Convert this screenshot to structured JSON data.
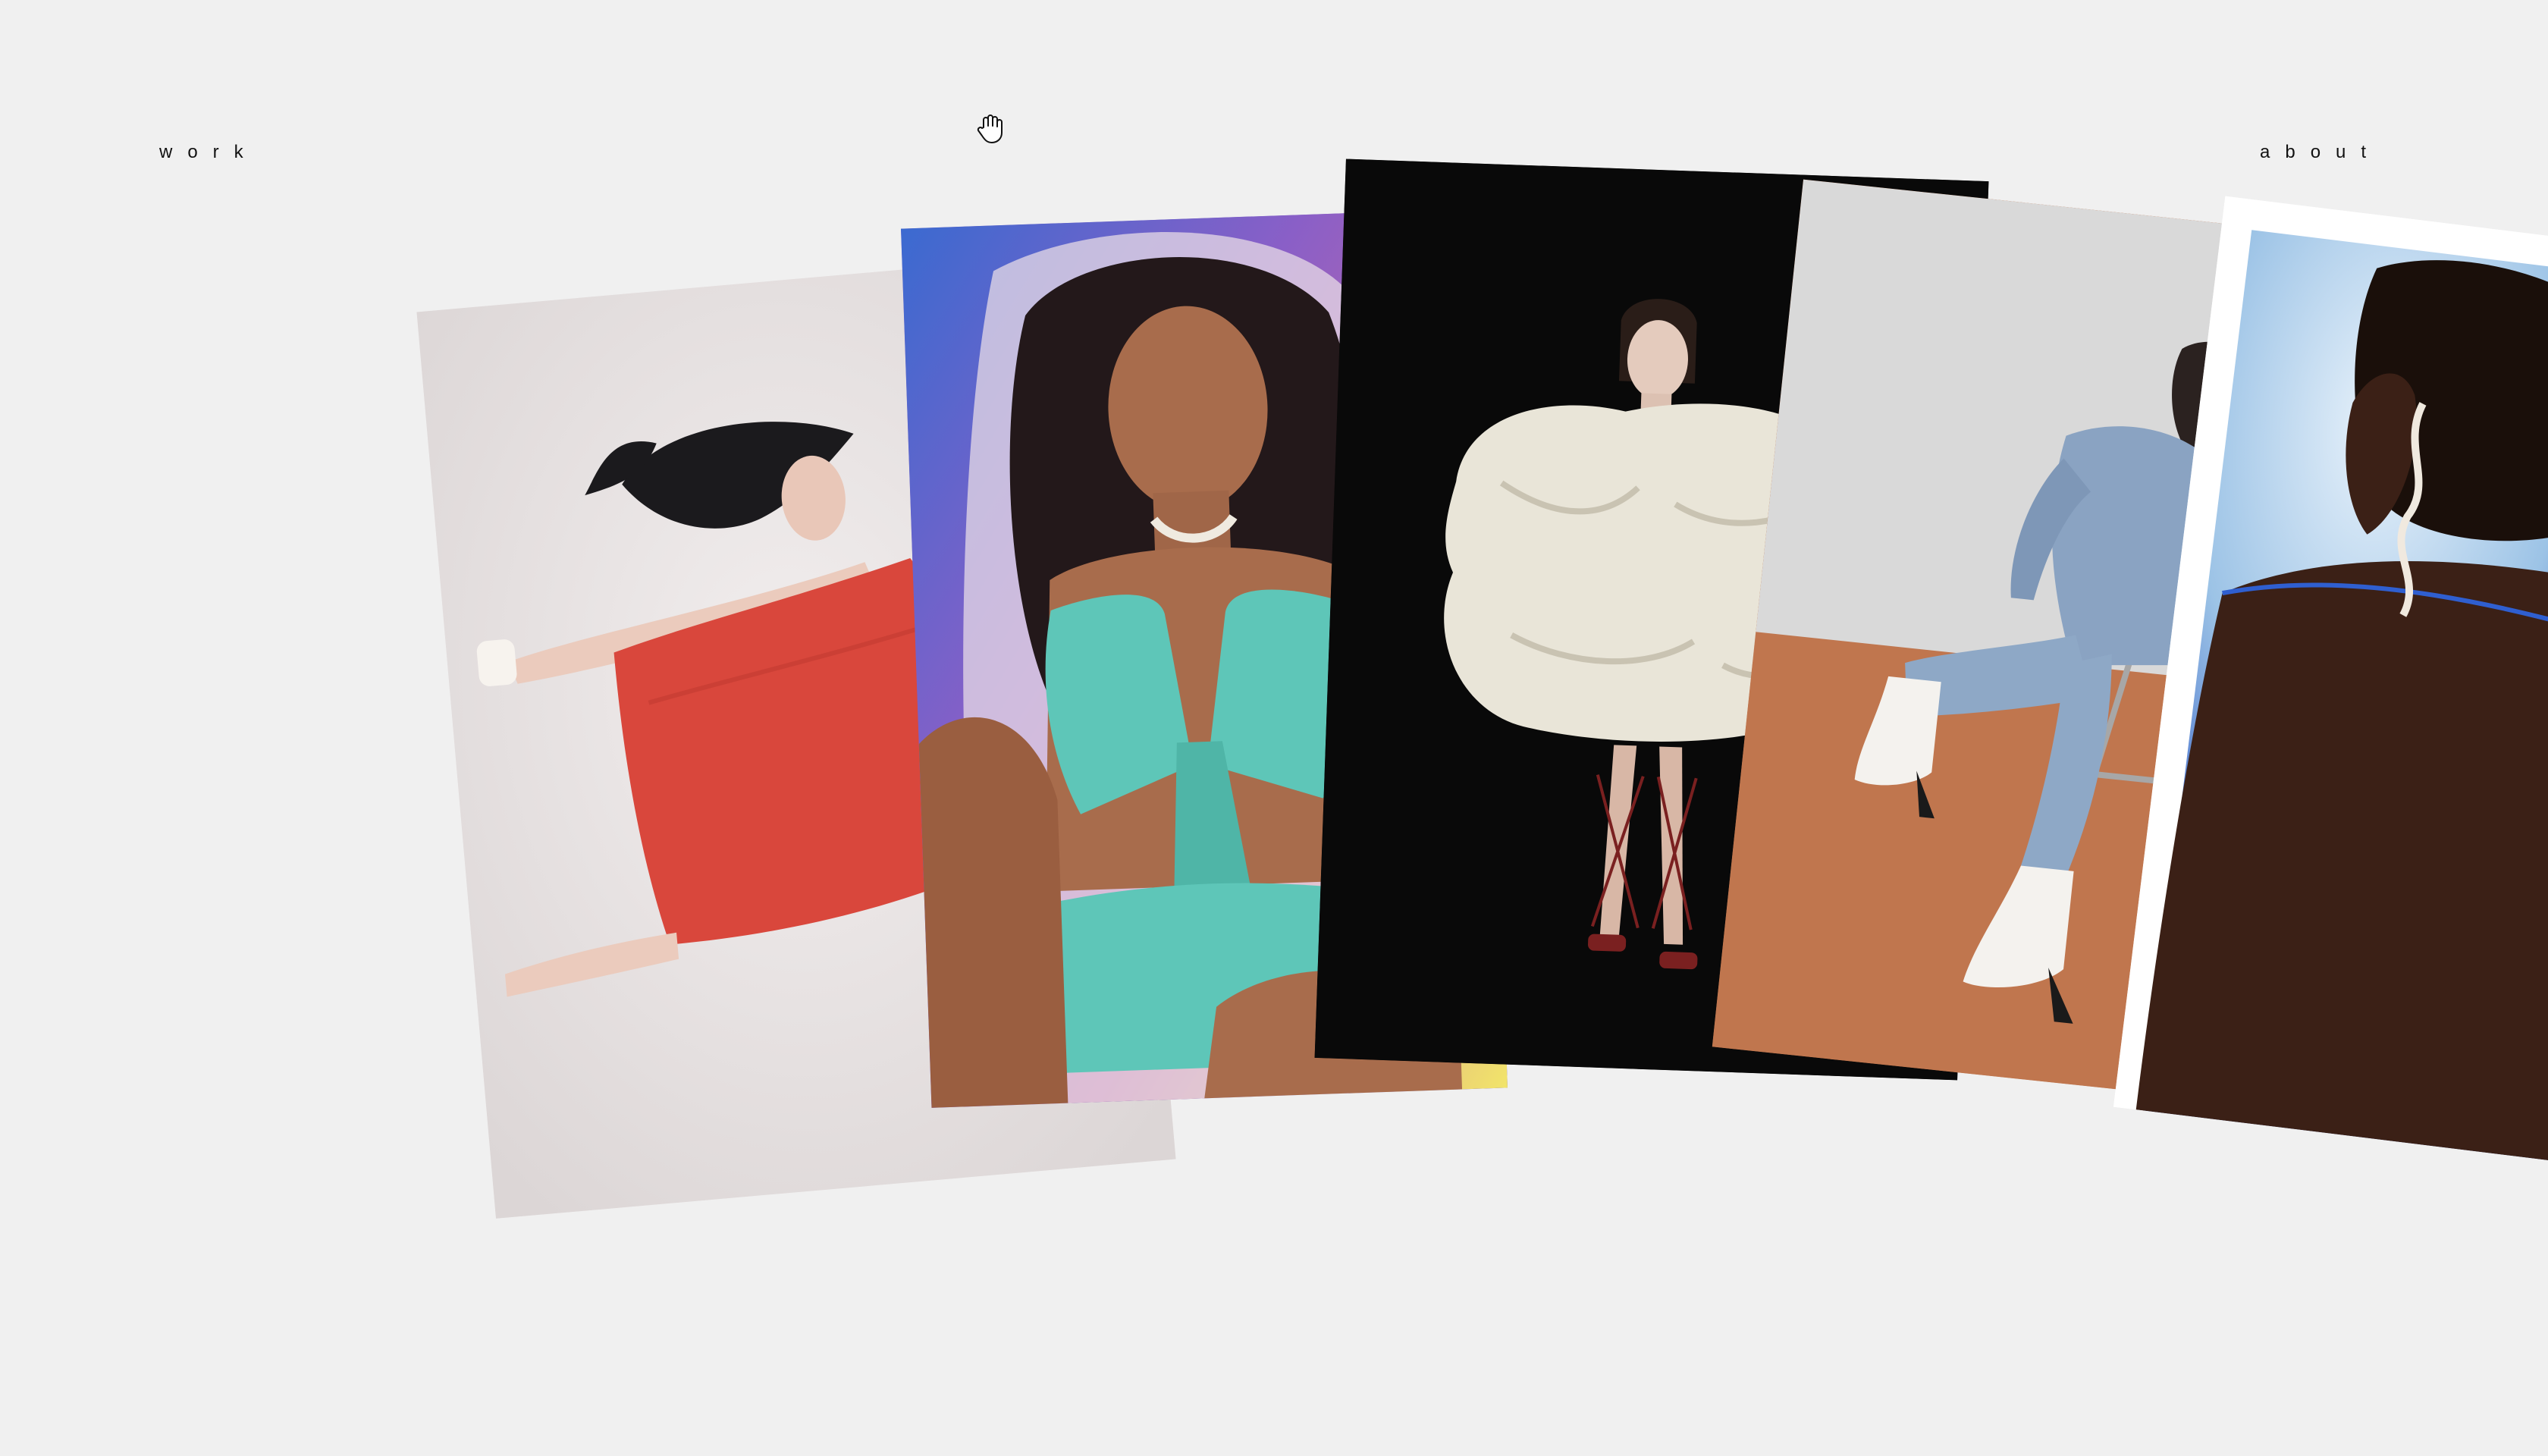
{
  "nav": {
    "work_label": "work",
    "about_label": "about"
  },
  "cursor": {
    "icon": "hand-grab-icon"
  },
  "gallery": {
    "cards": [
      {
        "name": "red-dress-photo",
        "palette": [
          "#e8e4e4",
          "#d9473c",
          "#1a1a1a"
        ]
      },
      {
        "name": "turquoise-swimwear-photo",
        "palette": [
          "#7b5fc2",
          "#5ec6b8",
          "#8b5a3c"
        ]
      },
      {
        "name": "white-volume-gown-photo",
        "palette": [
          "#0a0a0a",
          "#e9e5d8",
          "#7a2020"
        ]
      },
      {
        "name": "denim-boots-photo",
        "palette": [
          "#d8d8d8",
          "#c0764e",
          "#8aa3c2"
        ]
      },
      {
        "name": "watercolor-back-photo",
        "palette": [
          "#ffffff",
          "#3a64c8",
          "#3b2016"
        ]
      }
    ]
  },
  "colors": {
    "background": "#f0f0f0",
    "text": "#111111"
  }
}
